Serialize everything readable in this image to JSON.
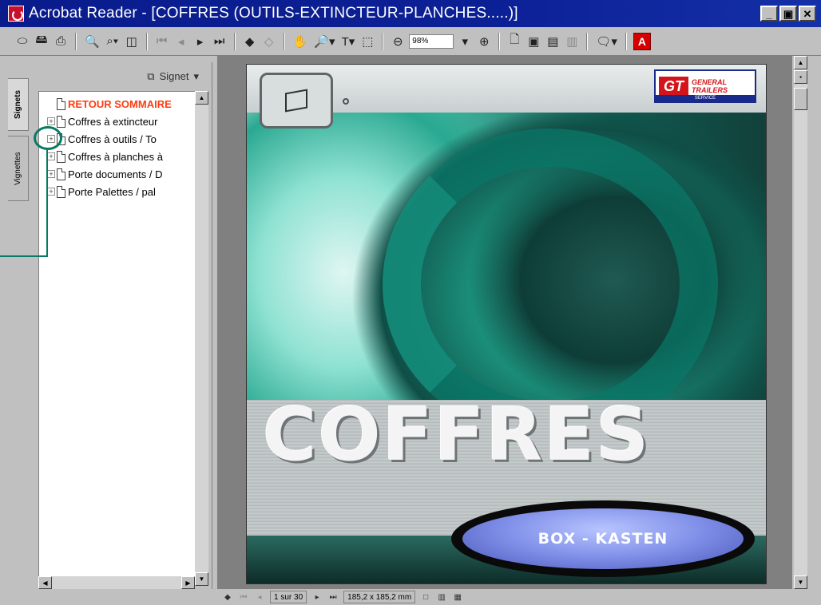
{
  "window": {
    "title": "Acrobat Reader - [COFFRES (OUTILS-EXTINCTEUR-PLANCHES.....)]",
    "controls": {
      "minimize": "_",
      "restore": "▣",
      "close": "✕"
    }
  },
  "toolbar": {
    "zoom_value": "98%",
    "icons": [
      "open-icon",
      "save-icon",
      "print-icon",
      "find-icon",
      "search-icon",
      "show-hide-icon",
      "first-page-icon",
      "prev-page-icon",
      "next-page-icon",
      "last-page-icon",
      "go-back-icon",
      "go-forward-icon",
      "hand-tool-icon",
      "zoom-tool-icon",
      "text-select-icon",
      "graphics-select-icon",
      "zoom-out-icon",
      "zoom-in-icon",
      "actual-size-icon",
      "fit-page-icon",
      "fit-width-icon",
      "reflow-icon",
      "comment-icon",
      "acrobat-logo-icon"
    ]
  },
  "nav": {
    "tabs": {
      "bookmarks": "Signets",
      "thumbnails": "Vignettes"
    },
    "menu_label": "Signet",
    "bookmarks": [
      {
        "label": "RETOUR SOMMAIRE",
        "expandable": false,
        "is_link": true
      },
      {
        "label": "Coffres à extincteur",
        "expandable": true,
        "is_link": false
      },
      {
        "label": "Coffres à outils / To",
        "expandable": true,
        "is_link": false
      },
      {
        "label": "Coffres à planches à",
        "expandable": true,
        "is_link": false
      },
      {
        "label": "Porte documents / D",
        "expandable": true,
        "is_link": false
      },
      {
        "label": "Porte Palettes / pal",
        "expandable": true,
        "is_link": false
      }
    ]
  },
  "document": {
    "title": "COFFRES",
    "badge": "BOX - KASTEN",
    "logo": {
      "mark": "GT",
      "line1": "GENERAL",
      "line2": "TRAILERS",
      "line3": "SERVICE"
    }
  },
  "status": {
    "page_indicator": "1 sur 30",
    "page_size": "185,2 x 185,2 mm"
  },
  "colors": {
    "titlebar": "#0c2096",
    "chrome": "#c0c0c0",
    "link_bookmark": "#ff3b10",
    "callout": "#0a7a66",
    "badge": "#7f8fe8"
  }
}
